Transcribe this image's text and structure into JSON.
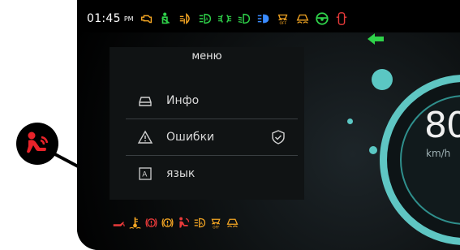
{
  "status_bar": {
    "time": "01:45",
    "ampm": "PM",
    "indicators": [
      {
        "icon": "engine-warning-icon",
        "color": "#f5a623"
      },
      {
        "icon": "seatbelt-icon",
        "color": "#2fd24a"
      },
      {
        "icon": "rear-fog-light-icon",
        "color": "#f5a623"
      },
      {
        "icon": "auto-high-beam-icon",
        "color": "#2fd24a"
      },
      {
        "icon": "parking-lights-icon",
        "color": "#2fd24a"
      },
      {
        "icon": "low-beam-icon",
        "color": "#2fd24a"
      },
      {
        "icon": "high-beam-icon",
        "color": "#3a8bff"
      },
      {
        "icon": "esp-off-icon",
        "color": "#f5a623"
      },
      {
        "icon": "stability-control-icon",
        "color": "#f5a623"
      },
      {
        "icon": "steering-wheel-icon",
        "color": "#2fd24a"
      },
      {
        "icon": "door-open-icon",
        "color": "#e83a3a"
      }
    ],
    "turn_signal": {
      "icon": "left-turn-arrow-icon",
      "color": "#2fd24a"
    }
  },
  "menu": {
    "title": "меню",
    "items": [
      {
        "label": "Инфо",
        "icon": "car-icon"
      },
      {
        "label": "Ошибки",
        "icon": "warning-icon",
        "badge_icon": "shield-check-icon"
      },
      {
        "label": "язык",
        "icon": "language-icon"
      }
    ]
  },
  "bottom_bar": {
    "indicators": [
      {
        "icon": "oil-pressure-icon",
        "color": "#e83a3a"
      },
      {
        "icon": "coolant-temp-icon",
        "color": "#f5a623"
      },
      {
        "icon": "brake-warning-icon",
        "color": "#e83a3a"
      },
      {
        "icon": "parking-brake-icon",
        "color": "#f5a623"
      },
      {
        "icon": "airbag-icon",
        "color": "#e83a3a"
      },
      {
        "icon": "auto-headlight-icon",
        "color": "#f5a623"
      },
      {
        "icon": "esp-off-icon",
        "color": "#f5a623"
      },
      {
        "icon": "stability-control-icon",
        "color": "#f5a623"
      }
    ]
  },
  "speedometer": {
    "value": "80",
    "unit": "km/h",
    "accent_color": "#5fc6c3"
  },
  "callout": {
    "icon": "airbag-icon",
    "color": "#e8232a"
  }
}
